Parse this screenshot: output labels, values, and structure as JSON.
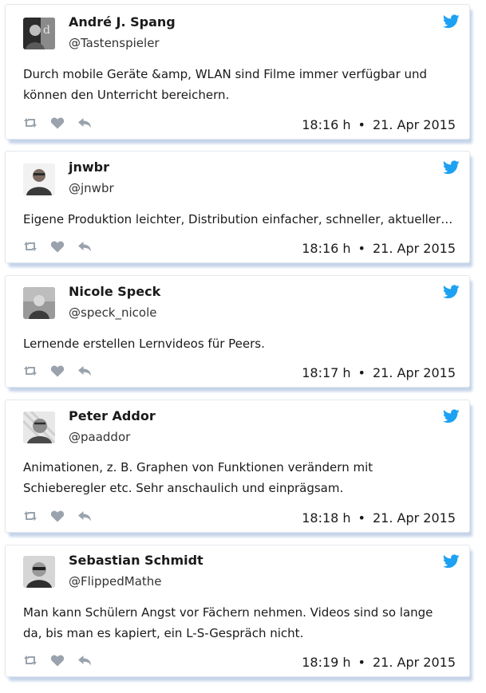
{
  "colors": {
    "brand_blue": "#1da1f2",
    "action_grey": "#9aa3ad",
    "card_shadow": "#c5d4ea"
  },
  "icons": {
    "brand": "twitter-bird-icon",
    "retweet": "retweet-icon",
    "like": "heart-icon",
    "reply": "reply-icon"
  },
  "timestamp_separator": "•",
  "tweets": [
    {
      "name": "André J. Spang",
      "handle": "@Tastenspieler",
      "text": "Durch mobile Geräte &amp, WLAN sind Filme immer verfügbar und können den Unterricht bereichern.",
      "time": "18:16 h",
      "date": "21. Apr 2015"
    },
    {
      "name": "jnwbr",
      "handle": "@jnwbr",
      "text": "Eigene Produktion leichter, Distribution einfacher, schneller, aktueller …",
      "time": "18:16 h",
      "date": "21. Apr 2015"
    },
    {
      "name": "Nicole Speck",
      "handle": "@speck_nicole",
      "text": "Lernende erstellen Lernvideos für Peers.",
      "time": "18:17 h",
      "date": "21. Apr 2015"
    },
    {
      "name": "Peter Addor",
      "handle": "@paaddor",
      "text": "Animationen, z. B. Graphen von Funktionen verändern mit Schieberegler etc. Sehr anschaulich und einprägsam.",
      "time": "18:18 h",
      "date": "21. Apr 2015"
    },
    {
      "name": "Sebastian Schmidt",
      "handle": "@FlippedMathe",
      "text": "Man kann Schülern Angst vor Fächern nehmen. Videos sind so lange da, bis man es kapiert, ein L-S-Gespräch nicht.",
      "time": "18:19 h",
      "date": "21. Apr 2015"
    }
  ]
}
